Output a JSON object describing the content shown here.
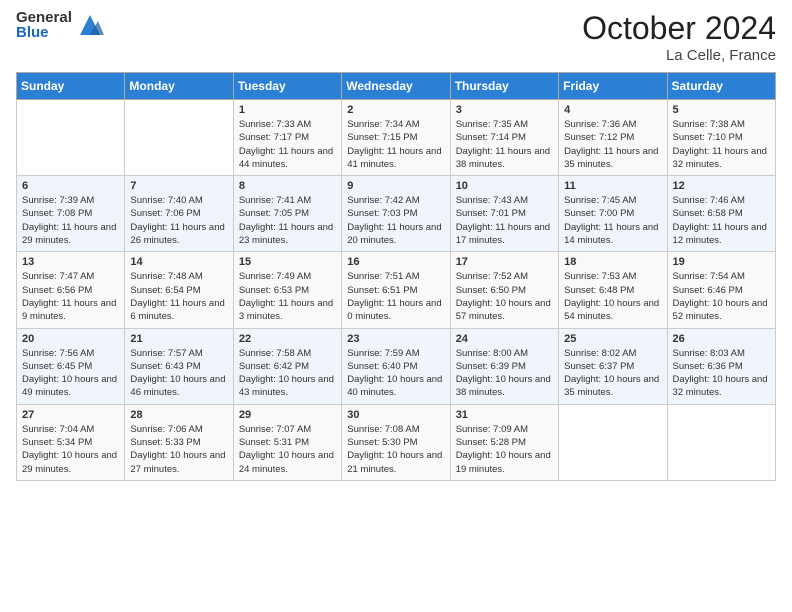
{
  "logo": {
    "general": "General",
    "blue": "Blue"
  },
  "header": {
    "month": "October 2024",
    "location": "La Celle, France"
  },
  "weekdays": [
    "Sunday",
    "Monday",
    "Tuesday",
    "Wednesday",
    "Thursday",
    "Friday",
    "Saturday"
  ],
  "weeks": [
    [
      {
        "day": "",
        "sunrise": "",
        "sunset": "",
        "daylight": ""
      },
      {
        "day": "",
        "sunrise": "",
        "sunset": "",
        "daylight": ""
      },
      {
        "day": "1",
        "sunrise": "Sunrise: 7:33 AM",
        "sunset": "Sunset: 7:17 PM",
        "daylight": "Daylight: 11 hours and 44 minutes."
      },
      {
        "day": "2",
        "sunrise": "Sunrise: 7:34 AM",
        "sunset": "Sunset: 7:15 PM",
        "daylight": "Daylight: 11 hours and 41 minutes."
      },
      {
        "day": "3",
        "sunrise": "Sunrise: 7:35 AM",
        "sunset": "Sunset: 7:14 PM",
        "daylight": "Daylight: 11 hours and 38 minutes."
      },
      {
        "day": "4",
        "sunrise": "Sunrise: 7:36 AM",
        "sunset": "Sunset: 7:12 PM",
        "daylight": "Daylight: 11 hours and 35 minutes."
      },
      {
        "day": "5",
        "sunrise": "Sunrise: 7:38 AM",
        "sunset": "Sunset: 7:10 PM",
        "daylight": "Daylight: 11 hours and 32 minutes."
      }
    ],
    [
      {
        "day": "6",
        "sunrise": "Sunrise: 7:39 AM",
        "sunset": "Sunset: 7:08 PM",
        "daylight": "Daylight: 11 hours and 29 minutes."
      },
      {
        "day": "7",
        "sunrise": "Sunrise: 7:40 AM",
        "sunset": "Sunset: 7:06 PM",
        "daylight": "Daylight: 11 hours and 26 minutes."
      },
      {
        "day": "8",
        "sunrise": "Sunrise: 7:41 AM",
        "sunset": "Sunset: 7:05 PM",
        "daylight": "Daylight: 11 hours and 23 minutes."
      },
      {
        "day": "9",
        "sunrise": "Sunrise: 7:42 AM",
        "sunset": "Sunset: 7:03 PM",
        "daylight": "Daylight: 11 hours and 20 minutes."
      },
      {
        "day": "10",
        "sunrise": "Sunrise: 7:43 AM",
        "sunset": "Sunset: 7:01 PM",
        "daylight": "Daylight: 11 hours and 17 minutes."
      },
      {
        "day": "11",
        "sunrise": "Sunrise: 7:45 AM",
        "sunset": "Sunset: 7:00 PM",
        "daylight": "Daylight: 11 hours and 14 minutes."
      },
      {
        "day": "12",
        "sunrise": "Sunrise: 7:46 AM",
        "sunset": "Sunset: 6:58 PM",
        "daylight": "Daylight: 11 hours and 12 minutes."
      }
    ],
    [
      {
        "day": "13",
        "sunrise": "Sunrise: 7:47 AM",
        "sunset": "Sunset: 6:56 PM",
        "daylight": "Daylight: 11 hours and 9 minutes."
      },
      {
        "day": "14",
        "sunrise": "Sunrise: 7:48 AM",
        "sunset": "Sunset: 6:54 PM",
        "daylight": "Daylight: 11 hours and 6 minutes."
      },
      {
        "day": "15",
        "sunrise": "Sunrise: 7:49 AM",
        "sunset": "Sunset: 6:53 PM",
        "daylight": "Daylight: 11 hours and 3 minutes."
      },
      {
        "day": "16",
        "sunrise": "Sunrise: 7:51 AM",
        "sunset": "Sunset: 6:51 PM",
        "daylight": "Daylight: 11 hours and 0 minutes."
      },
      {
        "day": "17",
        "sunrise": "Sunrise: 7:52 AM",
        "sunset": "Sunset: 6:50 PM",
        "daylight": "Daylight: 10 hours and 57 minutes."
      },
      {
        "day": "18",
        "sunrise": "Sunrise: 7:53 AM",
        "sunset": "Sunset: 6:48 PM",
        "daylight": "Daylight: 10 hours and 54 minutes."
      },
      {
        "day": "19",
        "sunrise": "Sunrise: 7:54 AM",
        "sunset": "Sunset: 6:46 PM",
        "daylight": "Daylight: 10 hours and 52 minutes."
      }
    ],
    [
      {
        "day": "20",
        "sunrise": "Sunrise: 7:56 AM",
        "sunset": "Sunset: 6:45 PM",
        "daylight": "Daylight: 10 hours and 49 minutes."
      },
      {
        "day": "21",
        "sunrise": "Sunrise: 7:57 AM",
        "sunset": "Sunset: 6:43 PM",
        "daylight": "Daylight: 10 hours and 46 minutes."
      },
      {
        "day": "22",
        "sunrise": "Sunrise: 7:58 AM",
        "sunset": "Sunset: 6:42 PM",
        "daylight": "Daylight: 10 hours and 43 minutes."
      },
      {
        "day": "23",
        "sunrise": "Sunrise: 7:59 AM",
        "sunset": "Sunset: 6:40 PM",
        "daylight": "Daylight: 10 hours and 40 minutes."
      },
      {
        "day": "24",
        "sunrise": "Sunrise: 8:00 AM",
        "sunset": "Sunset: 6:39 PM",
        "daylight": "Daylight: 10 hours and 38 minutes."
      },
      {
        "day": "25",
        "sunrise": "Sunrise: 8:02 AM",
        "sunset": "Sunset: 6:37 PM",
        "daylight": "Daylight: 10 hours and 35 minutes."
      },
      {
        "day": "26",
        "sunrise": "Sunrise: 8:03 AM",
        "sunset": "Sunset: 6:36 PM",
        "daylight": "Daylight: 10 hours and 32 minutes."
      }
    ],
    [
      {
        "day": "27",
        "sunrise": "Sunrise: 7:04 AM",
        "sunset": "Sunset: 5:34 PM",
        "daylight": "Daylight: 10 hours and 29 minutes."
      },
      {
        "day": "28",
        "sunrise": "Sunrise: 7:06 AM",
        "sunset": "Sunset: 5:33 PM",
        "daylight": "Daylight: 10 hours and 27 minutes."
      },
      {
        "day": "29",
        "sunrise": "Sunrise: 7:07 AM",
        "sunset": "Sunset: 5:31 PM",
        "daylight": "Daylight: 10 hours and 24 minutes."
      },
      {
        "day": "30",
        "sunrise": "Sunrise: 7:08 AM",
        "sunset": "Sunset: 5:30 PM",
        "daylight": "Daylight: 10 hours and 21 minutes."
      },
      {
        "day": "31",
        "sunrise": "Sunrise: 7:09 AM",
        "sunset": "Sunset: 5:28 PM",
        "daylight": "Daylight: 10 hours and 19 minutes."
      },
      {
        "day": "",
        "sunrise": "",
        "sunset": "",
        "daylight": ""
      },
      {
        "day": "",
        "sunrise": "",
        "sunset": "",
        "daylight": ""
      }
    ]
  ]
}
